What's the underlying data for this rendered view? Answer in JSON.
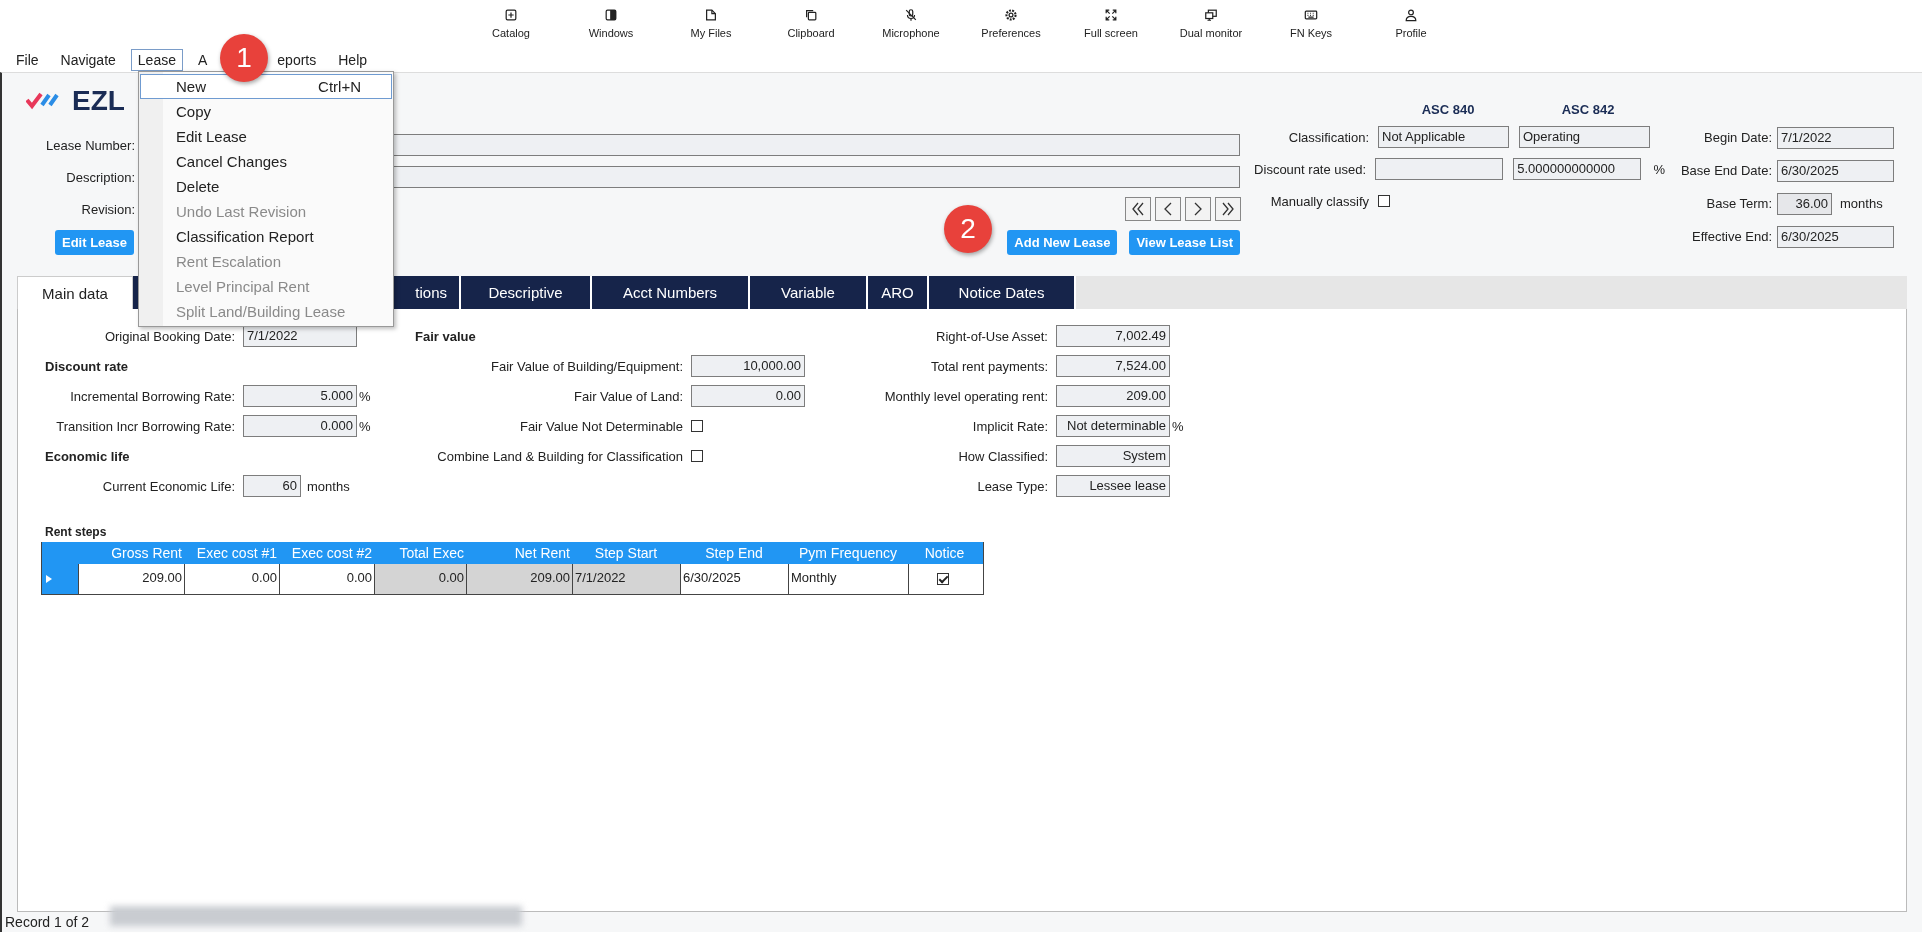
{
  "toolbar": [
    {
      "label": "Catalog"
    },
    {
      "label": "Windows"
    },
    {
      "label": "My Files"
    },
    {
      "label": "Clipboard"
    },
    {
      "label": "Microphone"
    },
    {
      "label": "Preferences"
    },
    {
      "label": "Full screen"
    },
    {
      "label": "Dual monitor"
    },
    {
      "label": "FN Keys"
    },
    {
      "label": "Profile"
    }
  ],
  "menubar": [
    {
      "label": "File",
      "selected": false
    },
    {
      "label": "Navigate",
      "selected": false
    },
    {
      "label": "Lease",
      "selected": true
    },
    {
      "label": "A",
      "selected": false
    },
    {
      "label": "eports",
      "selected": false
    },
    {
      "label": "Help",
      "selected": false
    }
  ],
  "lease_menu": [
    {
      "label": "New",
      "shortcut": "Ctrl+N",
      "selected": true,
      "disabled": false
    },
    {
      "label": "Copy",
      "selected": false,
      "disabled": false
    },
    {
      "label": "Edit Lease",
      "selected": false,
      "disabled": false
    },
    {
      "label": "Cancel Changes",
      "selected": false,
      "disabled": false
    },
    {
      "label": "Delete",
      "selected": false,
      "disabled": false
    },
    {
      "label": "Undo Last Revision",
      "selected": false,
      "disabled": true
    },
    {
      "label": "Classification Report",
      "selected": false,
      "disabled": false
    },
    {
      "label": "Rent Escalation",
      "selected": false,
      "disabled": true
    },
    {
      "label": "Level Principal Rent",
      "selected": false,
      "disabled": true
    },
    {
      "label": "Split Land/Building Lease",
      "selected": false,
      "disabled": true
    }
  ],
  "callouts": [
    "1",
    "2"
  ],
  "logo": "EZL",
  "lease_fields": [
    {
      "label": "Lease Number:"
    },
    {
      "label": "Description:"
    }
  ],
  "revision": {
    "label": "Revision:"
  },
  "buttons": {
    "edit": "Edit Lease",
    "add": "Add New Lease",
    "list": "View Lease List"
  },
  "classification": {
    "headings": [
      "ASC 840",
      "ASC 842"
    ],
    "rows": [
      {
        "label": "Classification:",
        "asc_840": "Not Applicable",
        "asc_842": "Operating"
      },
      {
        "label": "Discount rate used:",
        "asc_842": "5.000000000000",
        "unit": "%"
      }
    ],
    "manually_classify": {
      "label": "Manually classify",
      "checked": false
    }
  },
  "dates": [
    {
      "label": "Begin Date:",
      "value": "7/1/2022",
      "kind": "date"
    },
    {
      "label": "Base End Date:",
      "value": "6/30/2025",
      "kind": "date"
    },
    {
      "label": "Base Term:",
      "value": "36.00",
      "unit": "months",
      "kind": "number"
    },
    {
      "label": "Effective End:",
      "value": "6/30/2025",
      "kind": "date"
    }
  ],
  "tabs": [
    {
      "label": "Main data",
      "selected": true
    },
    {
      "label": "tions",
      "selected": false
    },
    {
      "label": "Descriptive",
      "selected": false
    },
    {
      "label": "Acct Numbers",
      "selected": false
    },
    {
      "label": "Variable",
      "selected": false
    },
    {
      "label": "ARO",
      "selected": false
    },
    {
      "label": "Notice Dates",
      "selected": false
    }
  ],
  "main_data": {
    "left": [
      {
        "kind": "date",
        "label": "Original Booking Date:",
        "value": "7/1/2022"
      },
      {
        "kind": "heading",
        "label": "Discount rate"
      },
      {
        "kind": "field",
        "label": "Incremental Borrowing Rate:",
        "value": "5.000",
        "unit": "%"
      },
      {
        "kind": "field",
        "label": "Transition Incr Borrowing Rate:",
        "value": "0.000",
        "unit": "%"
      },
      {
        "kind": "heading",
        "label": "Economic life"
      },
      {
        "kind": "small_field",
        "label": "Current Economic Life:",
        "value": "60",
        "unit": "months"
      }
    ],
    "middle": [
      {
        "kind": "heading",
        "label": "Fair value"
      },
      {
        "kind": "field",
        "label": "Fair Value of Building/Equipment:",
        "value": "10,000.00"
      },
      {
        "kind": "field",
        "label": "Fair Value of Land:",
        "value": "0.00"
      },
      {
        "kind": "checkbox",
        "label": "Fair Value Not Determinable",
        "checked": false
      },
      {
        "kind": "checkbox",
        "label": "Combine Land & Building for Classification",
        "checked": false
      }
    ],
    "right": [
      {
        "kind": "field",
        "label": "Right-of-Use Asset:",
        "value": "7,002.49"
      },
      {
        "kind": "field",
        "label": "Total rent payments:",
        "value": "7,524.00"
      },
      {
        "kind": "field",
        "label": "Monthly level operating rent:",
        "value": "209.00"
      },
      {
        "kind": "field",
        "label": "Implicit Rate:",
        "value": "Not determinable",
        "unit": "%"
      },
      {
        "kind": "field",
        "label": "How Classified:",
        "value": "System"
      },
      {
        "kind": "field",
        "label": "Lease Type:",
        "value": "Lessee lease"
      }
    ]
  },
  "rent_steps": {
    "title": "Rent steps",
    "columns": [
      {
        "label": "Gross Rent",
        "kind": "number",
        "readonly": false
      },
      {
        "label": "Exec cost #1",
        "kind": "number",
        "readonly": false
      },
      {
        "label": "Exec cost #2",
        "kind": "number",
        "readonly": false
      },
      {
        "label": "Total Exec",
        "kind": "number",
        "readonly": true
      },
      {
        "label": "Net Rent",
        "kind": "number",
        "readonly": true
      },
      {
        "label": "Step Start",
        "kind": "date",
        "readonly": true
      },
      {
        "label": "Step End",
        "kind": "date",
        "readonly": false
      },
      {
        "label": "Pym Frequency",
        "kind": "text",
        "readonly": false
      },
      {
        "label": "Notice",
        "kind": "check"
      }
    ],
    "rows": [
      {
        "selected": true,
        "cells": [
          "209.00",
          "0.00",
          "0.00",
          "0.00",
          "209.00",
          "7/1/2022",
          "6/30/2025",
          "Monthly"
        ],
        "notice": true
      }
    ]
  },
  "status_bar": {
    "record": "Record 1 of 2"
  }
}
